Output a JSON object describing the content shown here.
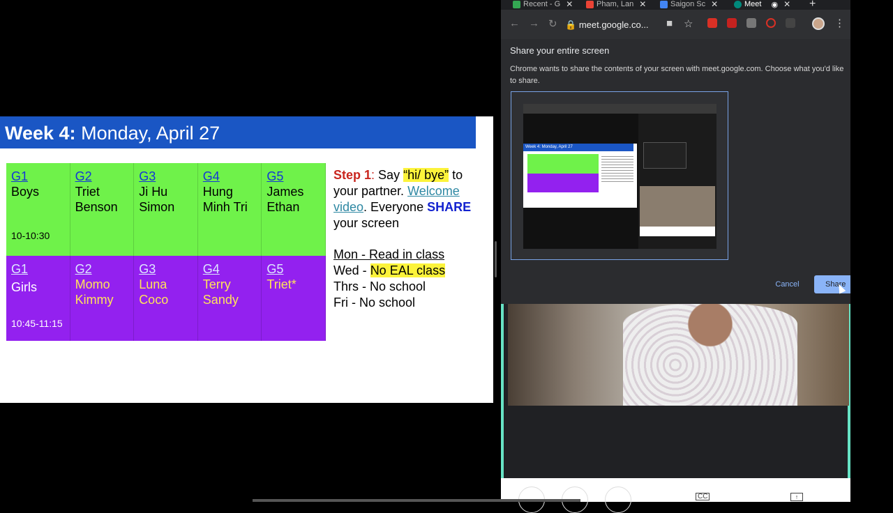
{
  "slide": {
    "title_bold": "Week 4:",
    "title_rest": "Monday, April 27",
    "row1": [
      {
        "group": "G1",
        "names": [
          "Boys"
        ],
        "time": "10-10:30"
      },
      {
        "group": "G2",
        "names": [
          "Triet",
          "Benson"
        ]
      },
      {
        "group": "G3",
        "names": [
          "Ji Hu",
          "Simon"
        ]
      },
      {
        "group": "G4",
        "names": [
          "Hung",
          "Minh Tri"
        ]
      },
      {
        "group": "G5",
        "names": [
          "James",
          "Ethan"
        ]
      }
    ],
    "row2": [
      {
        "group": "G1",
        "names": [
          "Girls"
        ],
        "time": "10:45-11:15"
      },
      {
        "group": "G2",
        "names": [
          "Momo",
          "Kimmy"
        ]
      },
      {
        "group": "G3",
        "names": [
          "Luna",
          "Coco"
        ]
      },
      {
        "group": "G4",
        "names": [
          "Terry",
          "Sandy"
        ]
      },
      {
        "group": "G5",
        "names": [
          "Triet*"
        ]
      }
    ],
    "step_label": "Step 1",
    "step_colon": ":",
    "step_say": " Say ",
    "step_quote": "“hi/ bye”",
    "step_to": " to your partner. ",
    "step_link": "Welcome video",
    "step_everyone": ". Everyone ",
    "step_share": "SHARE",
    "step_end": " your screen",
    "sched_mon": "Mon - Read in class",
    "sched_wed_a": "Wed - ",
    "sched_wed_b": "No EAL class",
    "sched_thu": "Thrs - No school",
    "sched_fri": "Fri - No school"
  },
  "browser": {
    "tabs": [
      "Recent - G",
      "Pham, Lan",
      "Saigon Sc",
      "Meet"
    ],
    "url": "meet.google.co...",
    "tab_colors": [
      "#34a853",
      "#ea4335",
      "#4285f4",
      "#00897b"
    ]
  },
  "dialog": {
    "title": "Share your entire screen",
    "description": "Chrome wants to share the contents of your screen with meet.google.com. Choose what you'd like to share.",
    "thumb_title": "Week 4: Monday, April 27",
    "cancel": "Cancel",
    "share": "Share"
  },
  "controls": {
    "cc": "CC",
    "present": "↑"
  }
}
